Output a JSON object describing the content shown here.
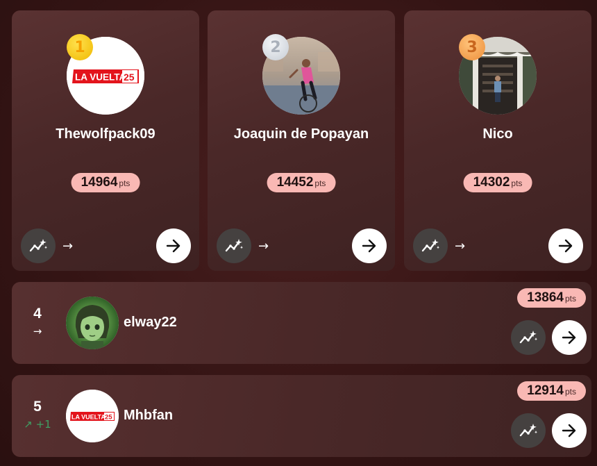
{
  "podium": [
    {
      "rank": "1",
      "name": "Thewolfpack09",
      "points": "14964",
      "points_unit": "pts",
      "trend": "→",
      "avatar": "la-vuelta-logo",
      "medal_color": "#f5c518"
    },
    {
      "rank": "2",
      "name": "Joaquin de Popayan",
      "points": "14452",
      "points_unit": "pts",
      "trend": "→",
      "avatar": "cyclist-photo",
      "medal_color": "#d6dbe1"
    },
    {
      "rank": "3",
      "name": "Nico",
      "points": "14302",
      "points_unit": "pts",
      "trend": "→",
      "avatar": "stairway-photo",
      "medal_color": "#f0a050"
    }
  ],
  "rows": [
    {
      "rank": "4",
      "change": "→",
      "name": "elway22",
      "points": "13864",
      "points_unit": "pts",
      "avatar": "anime-portrait"
    },
    {
      "rank": "5",
      "change": "↗ +1",
      "name": "Mhbfan",
      "points": "12914",
      "points_unit": "pts",
      "avatar": "la-vuelta-logo"
    }
  ],
  "logo_text": {
    "brand": "LA VUELTA",
    "year": "25"
  },
  "colors": {
    "background": "#3a1818",
    "pill": "#f9b8b4",
    "up": "#3fa064",
    "logo_red": "#e3141c"
  },
  "icons": {
    "stats_button": "sparkle-chart-icon",
    "go_button": "arrow-right-icon"
  }
}
